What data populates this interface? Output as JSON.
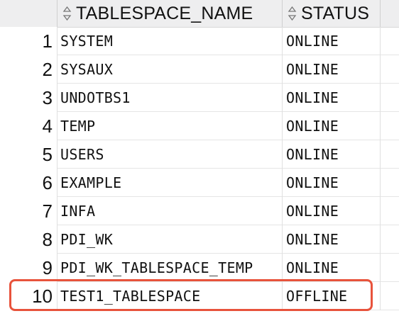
{
  "table": {
    "columns": [
      {
        "label": "TABLESPACE_NAME",
        "icon": "sort-icon"
      },
      {
        "label": "STATUS",
        "icon": "sort-icon"
      }
    ],
    "rows": [
      {
        "num": "1",
        "name": "SYSTEM",
        "status": "ONLINE"
      },
      {
        "num": "2",
        "name": "SYSAUX",
        "status": "ONLINE"
      },
      {
        "num": "3",
        "name": "UNDOTBS1",
        "status": "ONLINE"
      },
      {
        "num": "4",
        "name": "TEMP",
        "status": "ONLINE"
      },
      {
        "num": "5",
        "name": "USERS",
        "status": "ONLINE"
      },
      {
        "num": "6",
        "name": "EXAMPLE",
        "status": "ONLINE"
      },
      {
        "num": "7",
        "name": "INFA",
        "status": "ONLINE"
      },
      {
        "num": "8",
        "name": "PDI_WK",
        "status": "ONLINE"
      },
      {
        "num": "9",
        "name": "PDI_WK_TABLESPACE_TEMP",
        "status": "ONLINE"
      },
      {
        "num": "10",
        "name": "TEST1_TABLESPACE",
        "status": "OFFLINE"
      }
    ]
  },
  "highlight": {
    "row": "10",
    "color": "#e8533c"
  }
}
